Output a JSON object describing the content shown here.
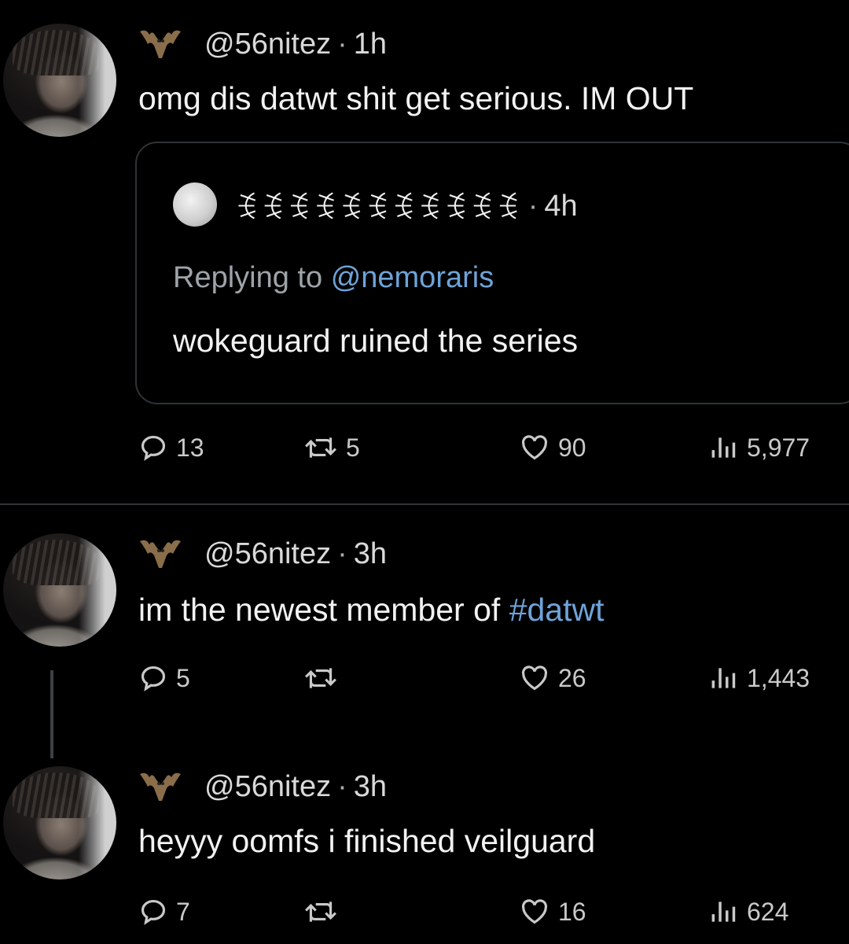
{
  "tweets": [
    {
      "handle": "@56nitez",
      "time": "1h",
      "text": "omg dis datwt shit get serious. IM OUT",
      "quote": {
        "name_glyphs": "ꉂꉂꉂꉂꉂꉂꉂꉂꉂꉂꉂ",
        "time": "4h",
        "replying_label": "Replying to",
        "replying_to": "@nemoraris",
        "text": "wokeguard ruined the series"
      },
      "stats": {
        "replies": "13",
        "retweets": "5",
        "likes": "90",
        "views": "5,977"
      }
    },
    {
      "handle": "@56nitez",
      "time": "3h",
      "text": "im the newest member of ",
      "hashtag": "#datwt",
      "stats": {
        "replies": "5",
        "retweets": "",
        "likes": "26",
        "views": "1,443"
      }
    },
    {
      "handle": "@56nitez",
      "time": "3h",
      "text": "heyyy oomfs i finished veilguard",
      "stats": {
        "replies": "7",
        "retweets": "",
        "likes": "16",
        "views": "624"
      }
    }
  ],
  "separator": "·",
  "icons": [
    "bat-icon",
    "reply-icon",
    "retweet-icon",
    "heart-icon",
    "views-icon"
  ],
  "colors": {
    "background": "#000000",
    "link": "#6fa3d8",
    "border": "#2f3336"
  }
}
